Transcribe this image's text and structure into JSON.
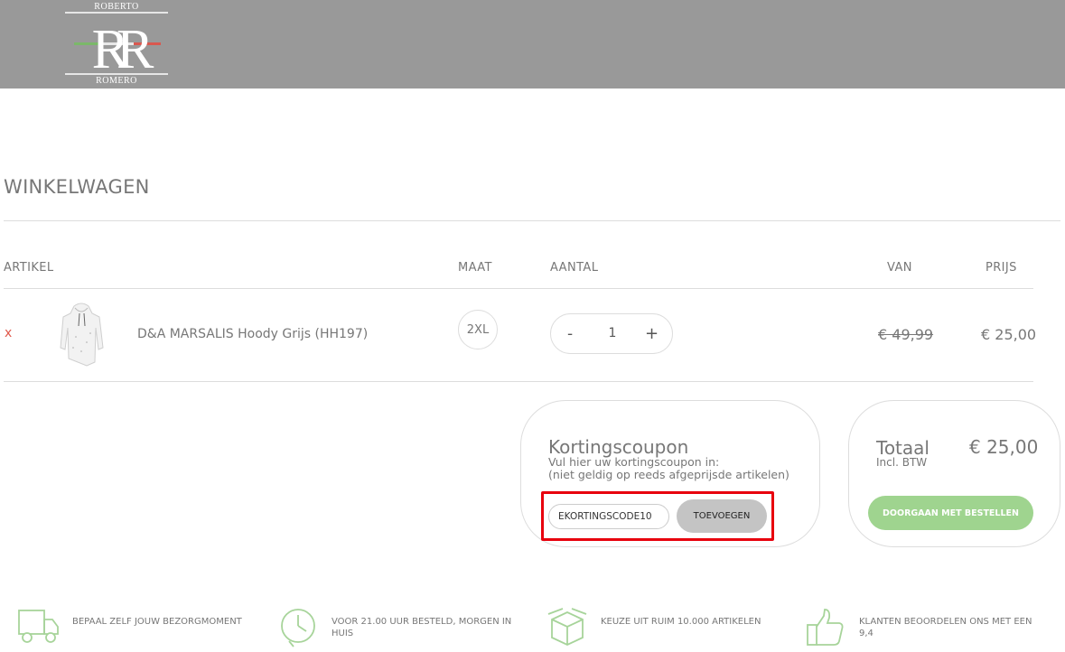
{
  "header": {
    "logo": {
      "top": "ROBERTO",
      "bottom": "ROMERO",
      "monogram": "RR"
    },
    "bg_color": "#999999"
  },
  "cart": {
    "title": "WINKELWAGEN",
    "columns": {
      "article": "ARTIKEL",
      "size": "MAAT",
      "quantity": "AANTAL",
      "from": "VAN",
      "price": "PRIJS"
    },
    "items": [
      {
        "remove": "x",
        "image_icon": "hoodie-icon",
        "name": "D&A MARSALIS Hoody Grijs (HH197)",
        "size": "2XL",
        "qty_minus": "-",
        "qty": "1",
        "qty_plus": "+",
        "old_price": "€ 49,99",
        "price": "€ 25,00"
      }
    ]
  },
  "coupon": {
    "title": "Kortingscoupon",
    "line1": "Vul hier uw kortingscoupon in:",
    "line2": "(niet geldig op reeds afgeprijsde artikelen)",
    "input_value": "EKORTINGSCODE10",
    "button": "TOEVOEGEN",
    "highlight_color": "#e8000d"
  },
  "totals": {
    "label": "Totaal",
    "sub": "Incl. BTW",
    "value": "€ 25,00",
    "checkout": "DOORGAAN MET BESTELLEN",
    "checkout_color": "#9fd48f"
  },
  "features": [
    {
      "icon": "truck-icon",
      "text": "BEPAAL ZELF JOUW BEZORGMOMENT"
    },
    {
      "icon": "clock-icon",
      "text": "VOOR 21.00 UUR BESTELD, MORGEN IN HUIS"
    },
    {
      "icon": "box-icon",
      "text": "KEUZE UIT RUIM 10.000 ARTIKELEN"
    },
    {
      "icon": "thumbs-up-icon",
      "text": "KLANTEN BEOORDELEN ONS MET EEN 9,4"
    }
  ],
  "feature_icon_color": "#a7d49a"
}
